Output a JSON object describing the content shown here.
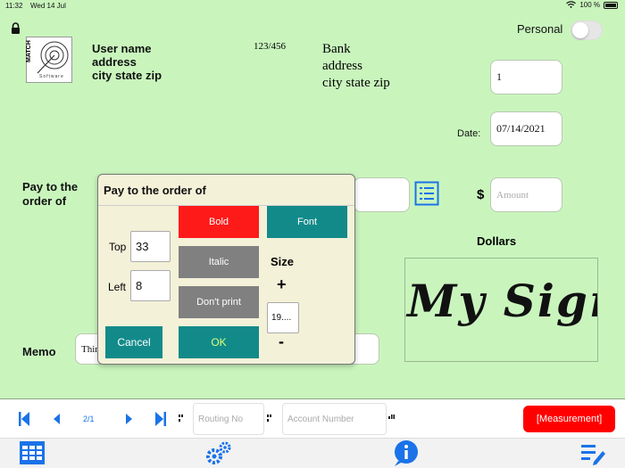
{
  "status": {
    "time": "11:32",
    "date": "Wed 14 Jul",
    "battery": "100 %"
  },
  "check": {
    "user": {
      "name": "User name",
      "address": "address",
      "city": "city state zip"
    },
    "routing_display": "123/456",
    "bank": {
      "name": "Bank",
      "address": "address",
      "city": "city state zip"
    },
    "personal_label": "Personal",
    "check_number": "1",
    "date_label": "Date:",
    "date_value": "07/14/2021",
    "pay_to_label": "Pay to the order of",
    "dollar_sign": "$",
    "amount_placeholder": "Amount",
    "dollars_label": "Dollars",
    "memo_label": "Memo",
    "memo_value": "Thin",
    "logo_text": "MATCH",
    "logo_sub": "Software",
    "signature_text": "My Sign"
  },
  "dialog": {
    "title": "Pay to the  order of",
    "bold_label": "Bold",
    "font_label": "Font",
    "italic_label": "Italic",
    "dont_print_label": "Don't print",
    "top_label": "Top",
    "top_value": "33",
    "left_label": "Left",
    "left_value": "8",
    "size_label": "Size",
    "plus_label": "+",
    "size_value": "19....",
    "minus_label": "-",
    "cancel_label": "Cancel",
    "ok_label": "OK"
  },
  "toolbar": {
    "page_indicator": "2/1",
    "routing_placeholder": "Routing No",
    "account_placeholder": "Account Number",
    "measurement_label": "[Measurement]"
  },
  "colors": {
    "check_bg": "#c9f5bd",
    "bold_button": "#ff1a1a",
    "font_button": "#138a8a",
    "gray_button": "#808080",
    "accent_blue": "#1a73e8"
  },
  "icons": [
    "lock-icon",
    "wifi-icon",
    "battery-icon",
    "list-icon",
    "first-page-icon",
    "prev-page-icon",
    "next-page-icon",
    "last-page-icon",
    "grid-icon",
    "gears-icon",
    "info-icon",
    "edit-list-icon"
  ]
}
